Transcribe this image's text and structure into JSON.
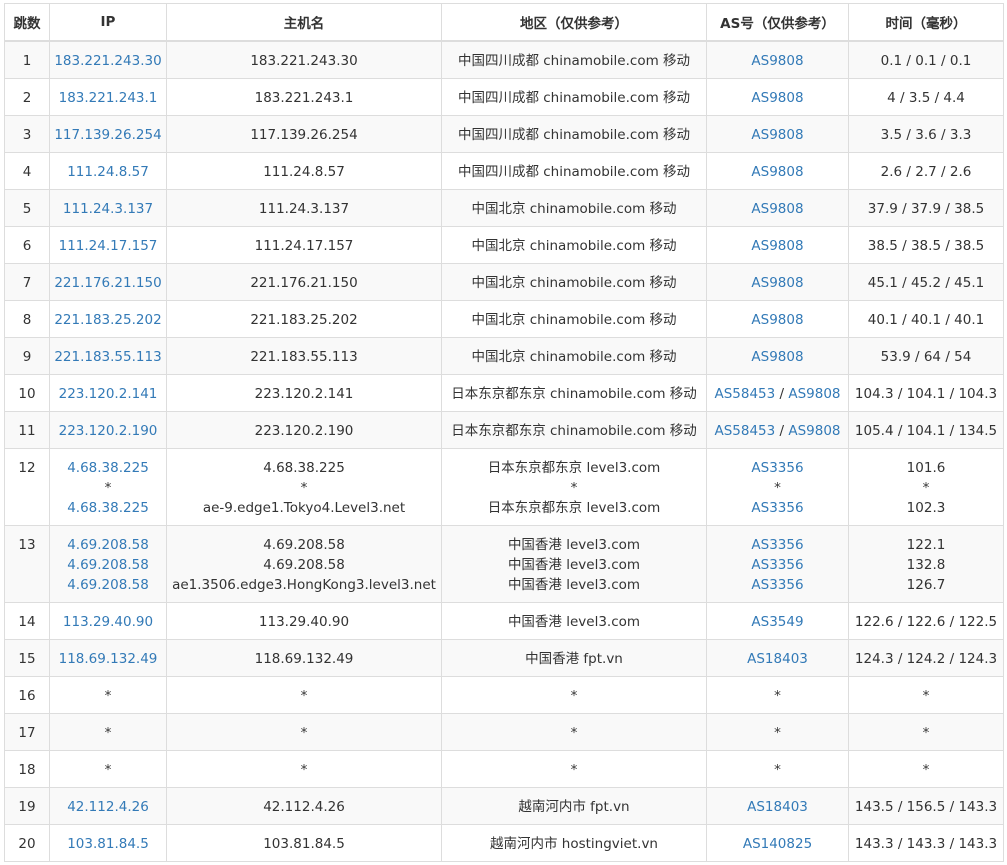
{
  "headers": [
    "跳数",
    "IP",
    "主机名",
    "地区（仅供参考）",
    "AS号（仅供参考）",
    "时间（毫秒）"
  ],
  "rows": [
    {
      "hop": "1",
      "lines": [
        {
          "ip": "183.221.243.30",
          "host": "183.221.243.30",
          "region": "中国四川成都 chinamobile.com 移动",
          "asn": [
            "AS9808"
          ],
          "time": "0.1 / 0.1 / 0.1"
        }
      ]
    },
    {
      "hop": "2",
      "lines": [
        {
          "ip": "183.221.243.1",
          "host": "183.221.243.1",
          "region": "中国四川成都 chinamobile.com 移动",
          "asn": [
            "AS9808"
          ],
          "time": "4 / 3.5 / 4.4"
        }
      ]
    },
    {
      "hop": "3",
      "lines": [
        {
          "ip": "117.139.26.254",
          "host": "117.139.26.254",
          "region": "中国四川成都 chinamobile.com 移动",
          "asn": [
            "AS9808"
          ],
          "time": "3.5 / 3.6 / 3.3"
        }
      ]
    },
    {
      "hop": "4",
      "lines": [
        {
          "ip": "111.24.8.57",
          "host": "111.24.8.57",
          "region": "中国四川成都 chinamobile.com 移动",
          "asn": [
            "AS9808"
          ],
          "time": "2.6 / 2.7 / 2.6"
        }
      ]
    },
    {
      "hop": "5",
      "lines": [
        {
          "ip": "111.24.3.137",
          "host": "111.24.3.137",
          "region": "中国北京 chinamobile.com 移动",
          "asn": [
            "AS9808"
          ],
          "time": "37.9 / 37.9 / 38.5"
        }
      ]
    },
    {
      "hop": "6",
      "lines": [
        {
          "ip": "111.24.17.157",
          "host": "111.24.17.157",
          "region": "中国北京 chinamobile.com 移动",
          "asn": [
            "AS9808"
          ],
          "time": "38.5 / 38.5 / 38.5"
        }
      ]
    },
    {
      "hop": "7",
      "lines": [
        {
          "ip": "221.176.21.150",
          "host": "221.176.21.150",
          "region": "中国北京 chinamobile.com 移动",
          "asn": [
            "AS9808"
          ],
          "time": "45.1 / 45.2 / 45.1"
        }
      ]
    },
    {
      "hop": "8",
      "lines": [
        {
          "ip": "221.183.25.202",
          "host": "221.183.25.202",
          "region": "中国北京 chinamobile.com 移动",
          "asn": [
            "AS9808"
          ],
          "time": "40.1 / 40.1 / 40.1"
        }
      ]
    },
    {
      "hop": "9",
      "lines": [
        {
          "ip": "221.183.55.113",
          "host": "221.183.55.113",
          "region": "中国北京 chinamobile.com 移动",
          "asn": [
            "AS9808"
          ],
          "time": "53.9 / 64 / 54"
        }
      ]
    },
    {
      "hop": "10",
      "lines": [
        {
          "ip": "223.120.2.141",
          "host": "223.120.2.141",
          "region": "日本东京都东京 chinamobile.com 移动",
          "asn": [
            "AS58453",
            "AS9808"
          ],
          "time": "104.3 / 104.1 / 104.3"
        }
      ]
    },
    {
      "hop": "11",
      "lines": [
        {
          "ip": "223.120.2.190",
          "host": "223.120.2.190",
          "region": "日本东京都东京 chinamobile.com 移动",
          "asn": [
            "AS58453",
            "AS9808"
          ],
          "time": "105.4 / 104.1 / 134.5"
        }
      ]
    },
    {
      "hop": "12",
      "lines": [
        {
          "ip": "4.68.38.225",
          "host": "4.68.38.225",
          "region": "日本东京都东京 level3.com",
          "asn": [
            "AS3356"
          ],
          "time": "101.6"
        },
        {
          "ip": "*",
          "host": "*",
          "region": "*",
          "asn": [
            "*"
          ],
          "time": "*"
        },
        {
          "ip": "4.68.38.225",
          "host": "ae-9.edge1.Tokyo4.Level3.net",
          "region": "日本东京都东京 level3.com",
          "asn": [
            "AS3356"
          ],
          "time": "102.3"
        }
      ]
    },
    {
      "hop": "13",
      "lines": [
        {
          "ip": "4.69.208.58",
          "host": "4.69.208.58",
          "region": "中国香港 level3.com",
          "asn": [
            "AS3356"
          ],
          "time": "122.1"
        },
        {
          "ip": "4.69.208.58",
          "host": "4.69.208.58",
          "region": "中国香港 level3.com",
          "asn": [
            "AS3356"
          ],
          "time": "132.8"
        },
        {
          "ip": "4.69.208.58",
          "host": "ae1.3506.edge3.HongKong3.level3.net",
          "region": "中国香港 level3.com",
          "asn": [
            "AS3356"
          ],
          "time": "126.7"
        }
      ]
    },
    {
      "hop": "14",
      "lines": [
        {
          "ip": "113.29.40.90",
          "host": "113.29.40.90",
          "region": "中国香港 level3.com",
          "asn": [
            "AS3549"
          ],
          "time": "122.6 / 122.6 / 122.5"
        }
      ]
    },
    {
      "hop": "15",
      "lines": [
        {
          "ip": "118.69.132.49",
          "host": "118.69.132.49",
          "region": "中国香港 fpt.vn",
          "asn": [
            "AS18403"
          ],
          "time": "124.3 / 124.2 / 124.3"
        }
      ]
    },
    {
      "hop": "16",
      "lines": [
        {
          "ip": "*",
          "host": "*",
          "region": "*",
          "asn": [
            "*"
          ],
          "time": "*"
        }
      ]
    },
    {
      "hop": "17",
      "lines": [
        {
          "ip": "*",
          "host": "*",
          "region": "*",
          "asn": [
            "*"
          ],
          "time": "*"
        }
      ]
    },
    {
      "hop": "18",
      "lines": [
        {
          "ip": "*",
          "host": "*",
          "region": "*",
          "asn": [
            "*"
          ],
          "time": "*"
        }
      ]
    },
    {
      "hop": "19",
      "lines": [
        {
          "ip": "42.112.4.26",
          "host": "42.112.4.26",
          "region": "越南河内市 fpt.vn",
          "asn": [
            "AS18403"
          ],
          "time": "143.5 / 156.5 / 143.3"
        }
      ]
    },
    {
      "hop": "20",
      "lines": [
        {
          "ip": "103.81.84.5",
          "host": "103.81.84.5",
          "region": "越南河内市 hostingviet.vn",
          "asn": [
            "AS140825"
          ],
          "time": "143.3 / 143.3 / 143.3"
        }
      ]
    }
  ],
  "separator": " / ",
  "colors": {
    "link": "#337ab7",
    "text": "#333333",
    "border": "#dddddd",
    "stripe": "#f9f9f9"
  }
}
